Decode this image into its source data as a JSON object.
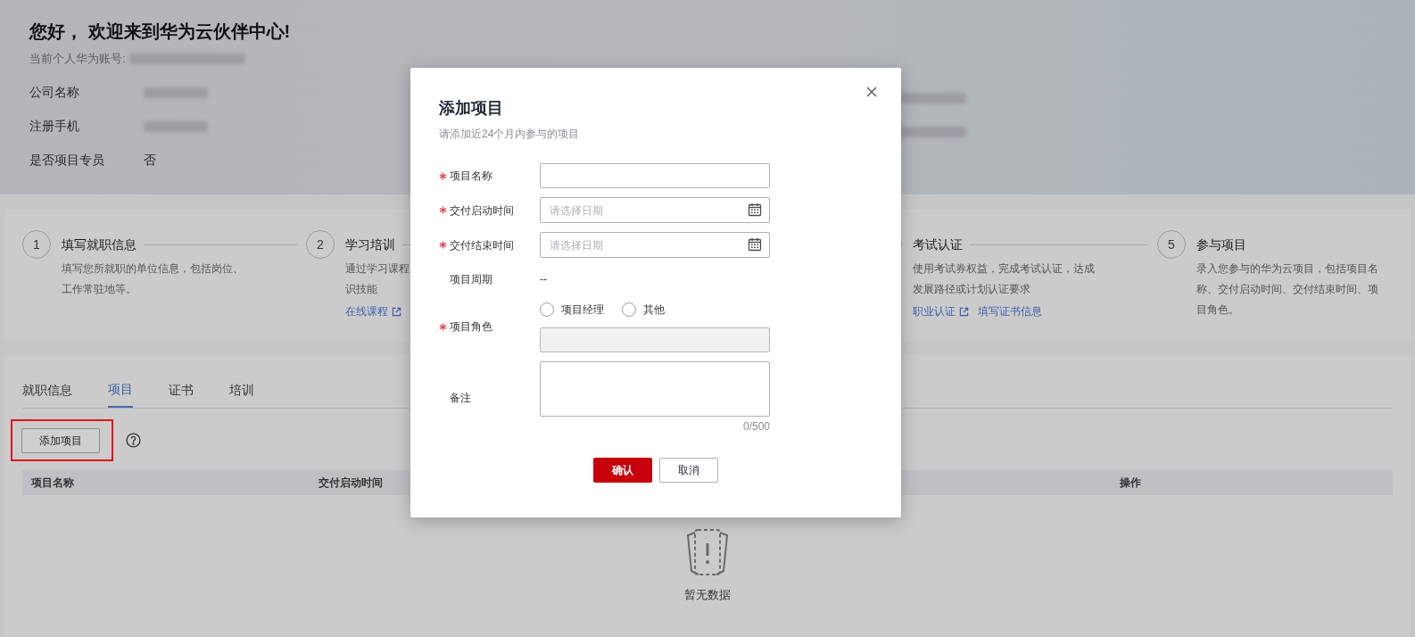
{
  "header": {
    "greeting": "您好， 欢迎来到华为云伙伴中心!",
    "account_label": "当前个人华为账号:",
    "fields": [
      {
        "label": "公司名称"
      },
      {
        "label": "注册手机"
      },
      {
        "label": "是否项目专员",
        "value": "否"
      }
    ]
  },
  "steps": [
    {
      "kind": "step",
      "number": "1",
      "title": "填写就职信息",
      "desc_lines": [
        "填写您所就职的单位信息，包括岗位、",
        "工作常驻地等。"
      ]
    },
    {
      "kind": "step",
      "number": "2",
      "title": "学习培训",
      "desc_lines": [
        "通过学习课程",
        "识技能"
      ],
      "links": [
        {
          "label": "在线课程",
          "external": true
        }
      ]
    },
    {
      "kind": "covered"
    },
    {
      "kind": "step",
      "title": "考试认证",
      "desc_lines": [
        "使用考试券权益，完成考试认证，达成",
        "发展路径或计划认证要求"
      ],
      "links": [
        {
          "label": "职业认证",
          "external": true
        },
        {
          "label": "填写证书信息",
          "external": false
        }
      ]
    },
    {
      "kind": "step",
      "number": "5",
      "title": "参与项目",
      "desc_lines": [
        "录入您参与的华为云项目，包括项目名",
        "称、交付启动时间、交付结束时间、项",
        "目角色。"
      ]
    }
  ],
  "tabs": [
    {
      "label": "就职信息",
      "selected": false
    },
    {
      "label": "项目",
      "selected": true
    },
    {
      "label": "证书",
      "selected": false
    },
    {
      "label": "培训",
      "selected": false
    }
  ],
  "add_button": {
    "label": "添加项目",
    "highlighted": true
  },
  "table": {
    "columns": [
      "项目名称",
      "交付启动时间",
      "操作"
    ],
    "empty_text": "暂无数据"
  },
  "dialog": {
    "title": "添加项目",
    "subtitle": "请添加近24个月内参与的项目",
    "fields": [
      {
        "kind": "text",
        "label": "项目名称",
        "required": true
      },
      {
        "kind": "date",
        "label": "交付启动时间",
        "required": true,
        "placeholder": "请选择日期"
      },
      {
        "kind": "date",
        "label": "交付结束时间",
        "required": true,
        "placeholder": "请选择日期"
      },
      {
        "kind": "static",
        "label": "项目周期",
        "required": false,
        "value": "--"
      },
      {
        "kind": "role",
        "label": "项目角色",
        "required": true,
        "options": [
          {
            "label": "项目经理",
            "selected": false
          },
          {
            "label": "其他",
            "selected": false
          }
        ],
        "disabled": true
      },
      {
        "kind": "textarea",
        "label": "备注",
        "required": false,
        "counter": "0/500"
      }
    ],
    "confirm": "确认",
    "cancel": "取消"
  }
}
